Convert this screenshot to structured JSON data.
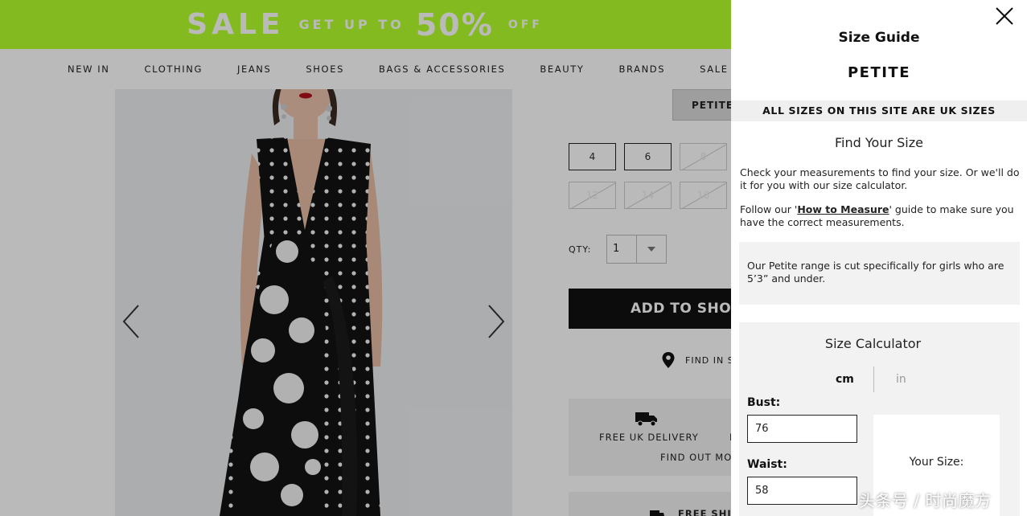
{
  "banner": {
    "sale": "SALE",
    "get_up_to": "GET UP TO",
    "percent": "50%",
    "off": "OFF",
    "color": "#b4ff2b"
  },
  "nav": {
    "items": [
      "NEW IN",
      "CLOTHING",
      "JEANS",
      "SHOES",
      "BAGS & ACCESSORIES",
      "BEAUTY",
      "BRANDS",
      "SALE"
    ]
  },
  "product": {
    "fit_tab": "PETITE",
    "sizes": [
      {
        "label": "4",
        "available": true
      },
      {
        "label": "6",
        "available": true
      },
      {
        "label": "8",
        "available": false
      },
      {
        "label": "12",
        "available": false
      },
      {
        "label": "14",
        "available": false
      },
      {
        "label": "16",
        "available": false
      }
    ],
    "qty_label": "QTY:",
    "qty_value": "1",
    "add_button": "ADD TO SHOPP",
    "find_in_store": "FIND IN ST",
    "delivery_title": "FREE UK DELIVERY",
    "delivery_trunc": "F",
    "delivery_link": "FIND OUT MO",
    "shipping_title": "FREE SHIP"
  },
  "size_guide": {
    "title": "Size Guide",
    "subtitle": "PETITE",
    "uk_notice": "ALL SIZES ON THIS SITE ARE UK SIZES",
    "find_heading": "Find Your Size",
    "intro": "Check your measurements to find your size. Or we'll do it for you with our size calculator.",
    "follow_prefix": "Follow our '",
    "follow_link": "How to Measure",
    "follow_suffix": "' guide to make sure you have the correct measurements.",
    "petite_note": "Our Petite range is cut specifically for girls who are 5’3” and under.",
    "calculator": {
      "title": "Size Calculator",
      "unit_cm": "cm",
      "unit_in": "in",
      "bust_label": "Bust:",
      "bust_value": "76",
      "waist_label": "Waist:",
      "waist_value": "58",
      "your_size_label": "Your Size:"
    }
  },
  "watermark": "头条号 / 时尚魔方"
}
